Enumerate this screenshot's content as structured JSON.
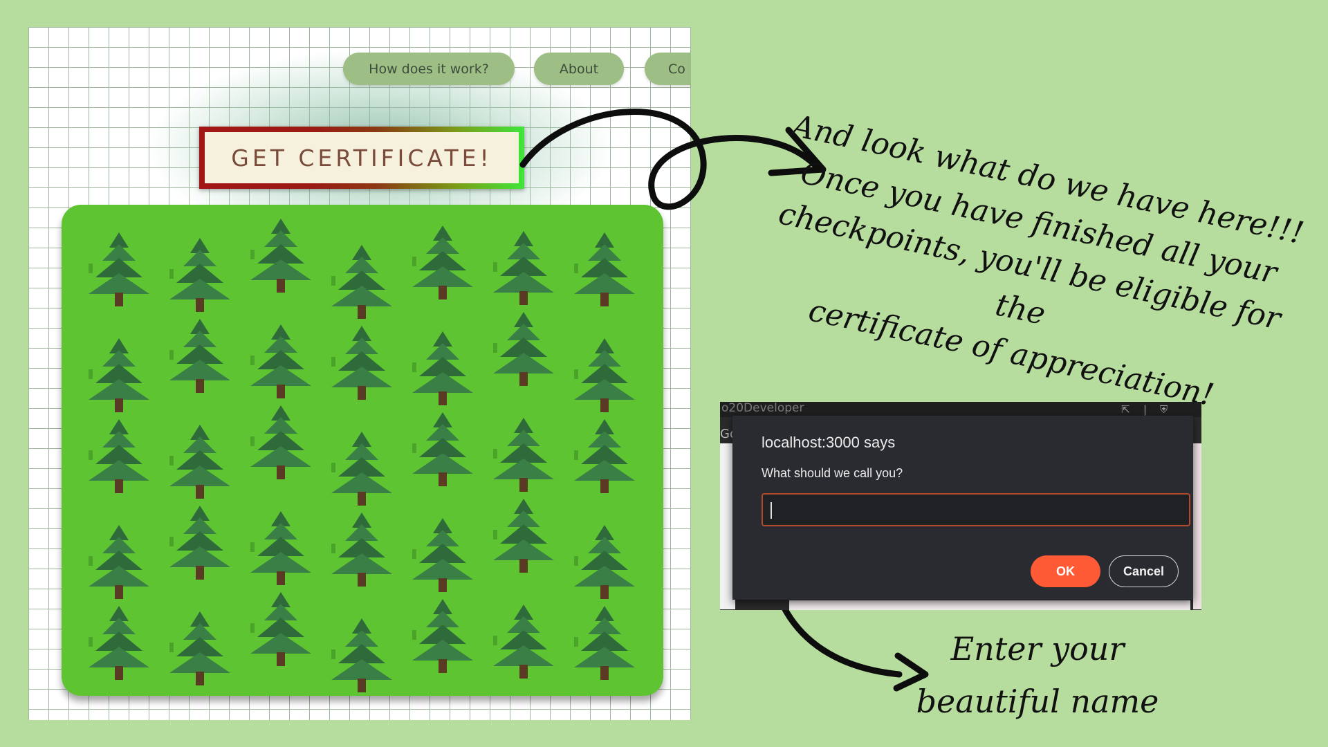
{
  "nav": {
    "how": "How does it work?",
    "about": "About",
    "contact": "Co"
  },
  "certificate_button": "GET CERTIFICATE!",
  "annotations": {
    "top": [
      "And look what do we have here!!!",
      "Once you have finished all your",
      "checkpoints, you'll be eligible for the",
      "certificate of appreciation!"
    ],
    "bottom": [
      "Enter your",
      "beautiful name"
    ]
  },
  "browser_fragment": {
    "tab_text": "o20Developer",
    "side_text": "Go"
  },
  "dialog": {
    "title": "localhost:3000 says",
    "message": "What should we call you?",
    "input_value": "",
    "ok": "OK",
    "cancel": "Cancel"
  },
  "colors": {
    "background": "#b6dd9d",
    "nav_pill": "#9dbe85",
    "forest": "#5fc432",
    "ok_button": "#ff5a36",
    "dialog_bg": "#2a2b30"
  },
  "icons": [
    "tree-icon",
    "share-icon",
    "shield-icon"
  ]
}
